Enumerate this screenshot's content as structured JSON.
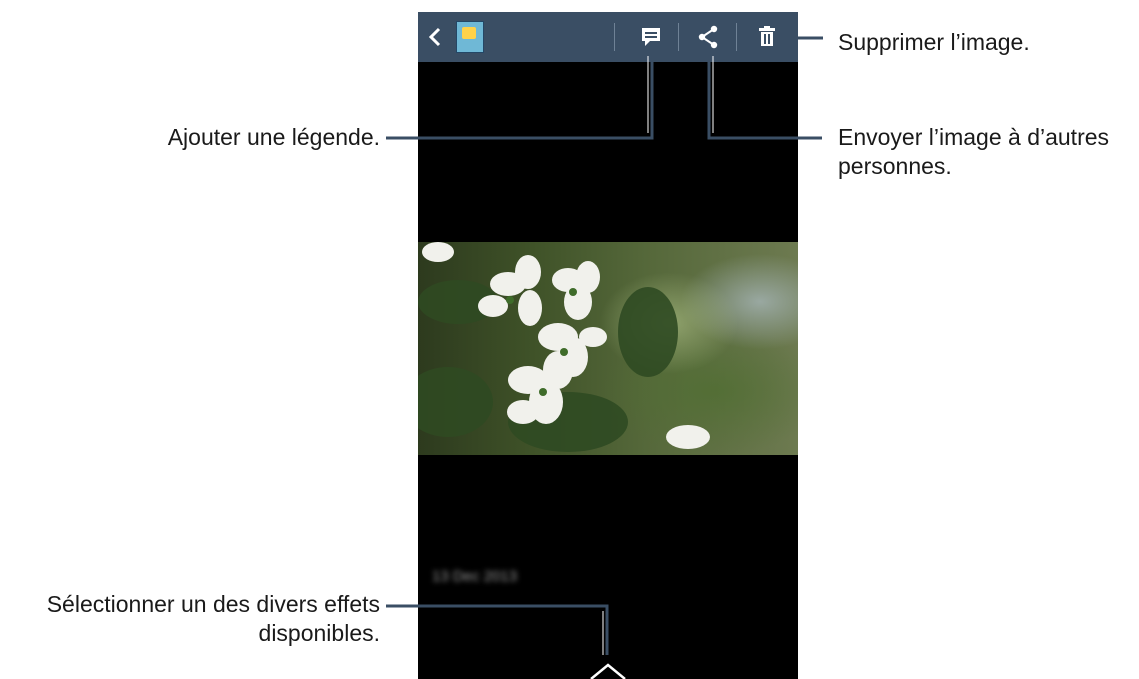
{
  "callouts": {
    "delete": "Supprimer l’image.",
    "caption": "Ajouter une légende.",
    "share_line1": "Envoyer l’image à d’autres",
    "share_line2": "personnes.",
    "effects_line1": "Sélectionner un des divers effets",
    "effects_line2": "disponibles."
  },
  "screen": {
    "date": "13 Dec 2013"
  },
  "icons": {
    "back": "chevron-left-icon",
    "album": "album-thumbnail-icon",
    "caption": "caption-icon",
    "share": "share-icon",
    "delete": "trash-icon",
    "effects": "chevron-up-icon"
  },
  "colors": {
    "action_bar": "#3a4e64",
    "screen_background": "#000000",
    "callout_line": "#3a4e64",
    "text": "#1a1a1a"
  }
}
